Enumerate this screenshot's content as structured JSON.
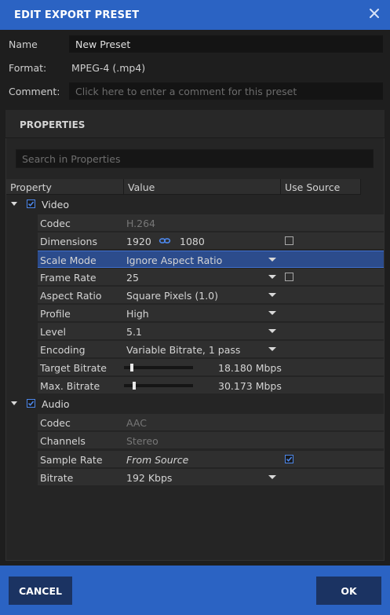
{
  "dialog": {
    "title": "EDIT EXPORT PRESET",
    "close_icon": "close-icon"
  },
  "fields": {
    "name_label": "Name",
    "name_value": "New Preset",
    "format_label": "Format:",
    "format_value": "MPEG-4 (.mp4)",
    "comment_label": "Comment:",
    "comment_placeholder": "Click here to enter a comment for this preset"
  },
  "properties": {
    "header": "PROPERTIES",
    "search_placeholder": "Search in Properties",
    "columns": [
      "Property",
      "Value",
      "Use Source"
    ],
    "video": {
      "label": "Video",
      "enabled": true,
      "codec": {
        "label": "Codec",
        "value": "H.264"
      },
      "dimensions": {
        "label": "Dimensions",
        "width": "1920",
        "height": "1080",
        "link_icon": "link-icon",
        "use_source": false
      },
      "scale_mode": {
        "label": "Scale Mode",
        "value": "Ignore Aspect Ratio",
        "selected": true
      },
      "frame_rate": {
        "label": "Frame Rate",
        "value": "25",
        "use_source": false
      },
      "aspect_ratio": {
        "label": "Aspect Ratio",
        "value": "Square Pixels (1.0)"
      },
      "profile": {
        "label": "Profile",
        "value": "High"
      },
      "level": {
        "label": "Level",
        "value": "5.1"
      },
      "encoding": {
        "label": "Encoding",
        "value": "Variable Bitrate, 1 pass"
      },
      "target_bitrate": {
        "label": "Target Bitrate",
        "value": "18.180 Mbps",
        "slider_fraction": 0.09
      },
      "max_bitrate": {
        "label": "Max. Bitrate",
        "value": "30.173 Mbps",
        "slider_fraction": 0.13
      }
    },
    "audio": {
      "label": "Audio",
      "enabled": true,
      "codec": {
        "label": "Codec",
        "value": "AAC"
      },
      "channels": {
        "label": "Channels",
        "value": "Stereo"
      },
      "sample_rate": {
        "label": "Sample Rate",
        "value": "From Source",
        "use_source": true
      },
      "bitrate": {
        "label": "Bitrate",
        "value": "192 Kbps"
      }
    }
  },
  "buttons": {
    "cancel": "CANCEL",
    "ok": "OK"
  },
  "colors": {
    "accent": "#2b63c3",
    "button_bg": "#1b3362",
    "selected_row": "#2c4c8c",
    "checkbox_accent": "#4d87ea"
  }
}
